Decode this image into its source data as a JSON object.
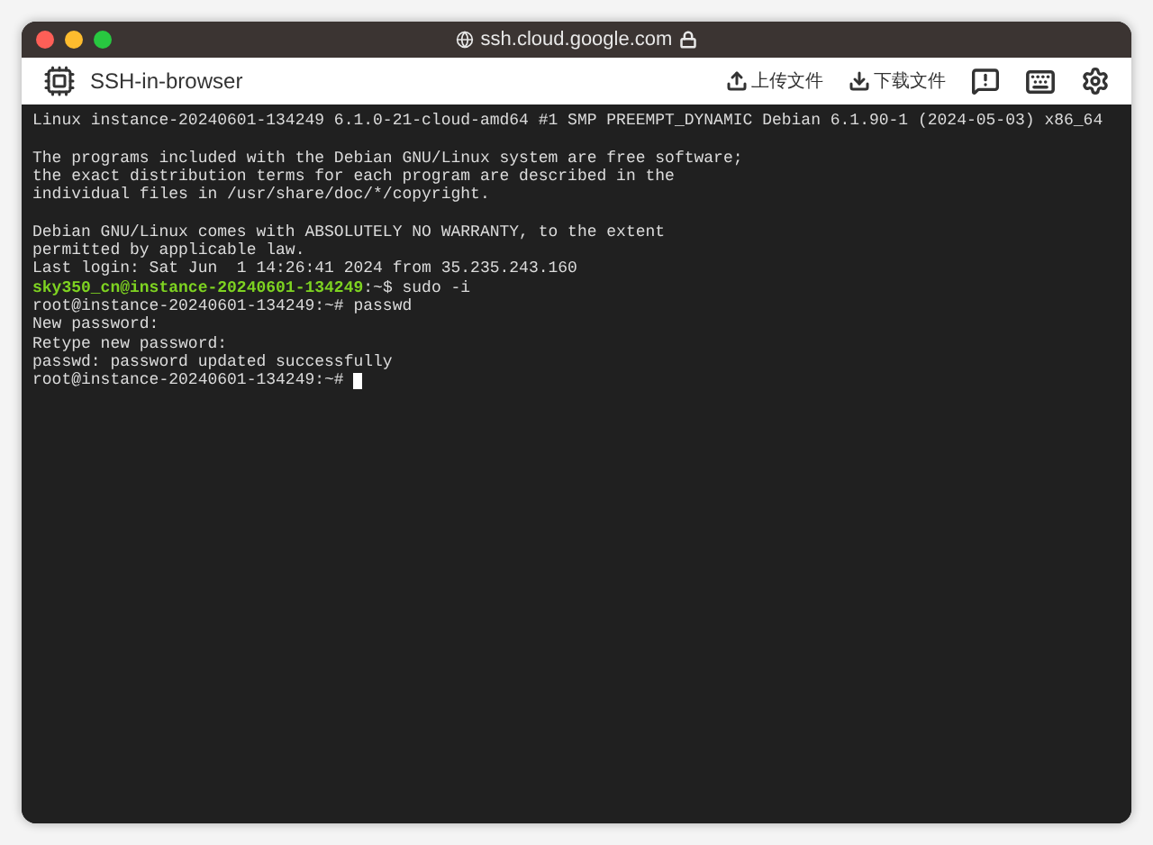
{
  "window": {
    "title": "ssh.cloud.google.com",
    "secure": true
  },
  "toolbar": {
    "app_name": "SSH-in-browser",
    "actions": [
      {
        "kind": "upload",
        "label": "上传文件"
      },
      {
        "kind": "download",
        "label": "下载文件"
      },
      {
        "kind": "feedback"
      },
      {
        "kind": "keyboard"
      },
      {
        "kind": "settings"
      }
    ]
  },
  "terminal": {
    "lines": [
      {
        "kind": "text",
        "text": "Linux instance-20240601-134249 6.1.0-21-cloud-amd64 #1 SMP PREEMPT_DYNAMIC Debian 6.1.90-1 (2024-05-03) x86_64"
      },
      {
        "kind": "blank"
      },
      {
        "kind": "text",
        "text": "The programs included with the Debian GNU/Linux system are free software;"
      },
      {
        "kind": "text",
        "text": "the exact distribution terms for each program are described in the"
      },
      {
        "kind": "text",
        "text": "individual files in /usr/share/doc/*/copyright."
      },
      {
        "kind": "blank"
      },
      {
        "kind": "text",
        "text": "Debian GNU/Linux comes with ABSOLUTELY NO WARRANTY, to the extent"
      },
      {
        "kind": "text",
        "text": "permitted by applicable law."
      },
      {
        "kind": "text",
        "text": "Last login: Sat Jun  1 14:26:41 2024 from 35.235.243.160"
      },
      {
        "kind": "prompt",
        "user": "sky350_cn@instance-20240601-134249",
        "text": ":~$ sudo -i"
      },
      {
        "kind": "text",
        "text": "root@instance-20240601-134249:~# passwd"
      },
      {
        "kind": "text",
        "text": "New password:"
      },
      {
        "kind": "text",
        "text": "Retype new password:"
      },
      {
        "kind": "text",
        "text": "passwd: password updated successfully"
      },
      {
        "kind": "text",
        "text": "root@instance-20240601-134249:~#",
        "cursor": true
      }
    ]
  }
}
